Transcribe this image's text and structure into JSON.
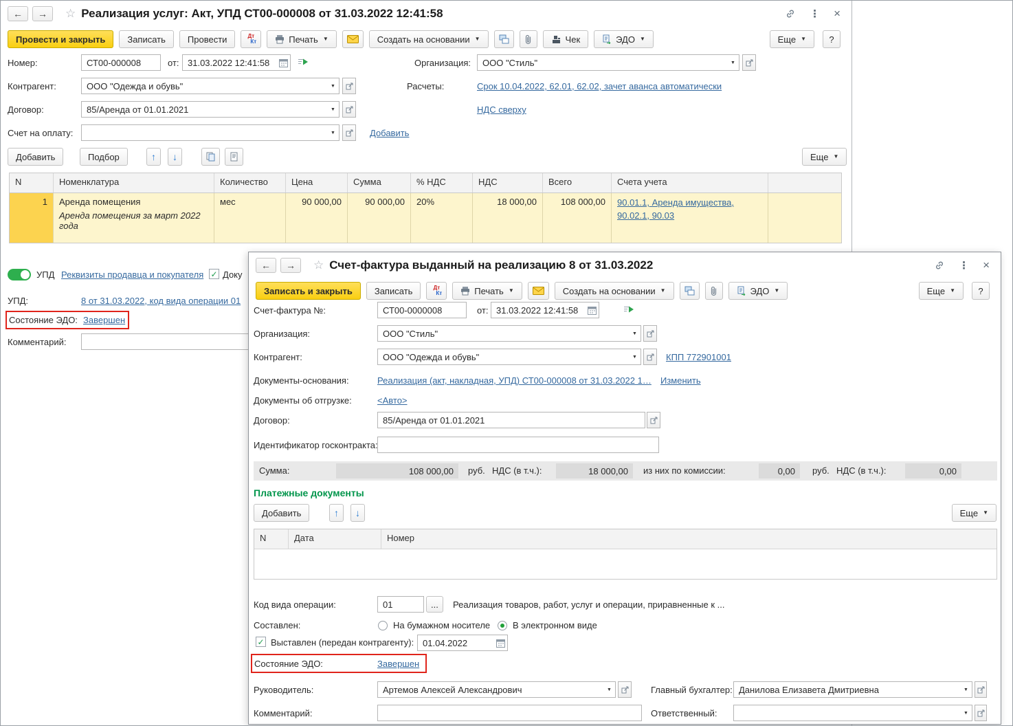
{
  "colors": {
    "accent_yellow": "#f9cf11",
    "link_blue": "#35699f",
    "section_green": "#00954b",
    "row_highlight_yellow": "#fdf5cd",
    "selected_cell_yellow": "#fcd34f",
    "annotation_red": "#e0241b",
    "toggle_green": "#2eaf4e",
    "sum_bar_gray": "#e9e9e9"
  },
  "icons": {
    "back": "←",
    "forward": "→",
    "star": "☆",
    "dots": "⋮",
    "close": "×",
    "caret": "▼",
    "dropdown": "▼",
    "up": "↑",
    "down": "↓",
    "check": "✓",
    "ellipsis": "..."
  },
  "window1": {
    "title": "Реализация услуг: Акт, УПД СТ00-000008 от 31.03.2022 12:41:58",
    "toolbar": {
      "post_and_close": "Провести и закрыть",
      "write": "Записать",
      "post": "Провести",
      "dt": "Дт",
      "kt": "Кт",
      "print": "Печать",
      "create_on_basis": "Создать на основании",
      "check": "Чек",
      "edo": "ЭДО",
      "more": "Еще",
      "help": "?"
    },
    "fields": {
      "number_label": "Номер:",
      "number": "СТ00-000008",
      "from_label": "от:",
      "date": "31.03.2022 12:41:58",
      "organization_label": "Организация:",
      "organization": "ООО \"Стиль\"",
      "contractor_label": "Контрагент:",
      "contractor": "ООО \"Одежда и обувь\"",
      "settlements_label": "Расчеты:",
      "settlements_link": "Срок 10.04.2022, 62.01, 62.02, зачет аванса автоматически",
      "contract_label": "Договор:",
      "contract": "85/Аренда от 01.01.2021",
      "vat_link": "НДС сверху",
      "payment_invoice_label": "Счет на оплату:",
      "add_link": "Добавить"
    },
    "items_toolbar": {
      "add": "Добавить",
      "pick": "Подбор",
      "more": "Еще"
    },
    "items_table": {
      "headers": [
        "N",
        "Номенклатура",
        "Количество",
        "Цена",
        "Сумма",
        "% НДС",
        "НДС",
        "Всего",
        "Счета учета"
      ],
      "rows": [
        {
          "n": "1",
          "name": "Аренда помещения",
          "note": "Аренда помещения за март 2022 года",
          "unit": "мес",
          "price": "90 000,00",
          "amount": "90 000,00",
          "vat_rate": "20%",
          "vat": "18 000,00",
          "total": "108 000,00",
          "accounts": "90.01.1, Аренда имущества, 90.02.1, 90.03"
        }
      ]
    },
    "footer": {
      "upd_toggle_label": "УПД",
      "seller_buyer_link": "Реквизиты продавца и покупателя",
      "doc_checkbox_label": "Доку",
      "upd_label": "УПД:",
      "upd_link": "8 от 31.03.2022, код вида операции 01",
      "edo_state_label": "Состояние ЭДО:",
      "edo_state_value": "Завершен",
      "comment_label": "Комментарий:"
    }
  },
  "window2": {
    "title": "Счет-фактура выданный на реализацию 8 от 31.03.2022",
    "toolbar": {
      "write_and_close": "Записать и закрыть",
      "write": "Записать",
      "dt": "Дт",
      "kt": "Кт",
      "print": "Печать",
      "create_on_basis": "Создать на основании",
      "edo": "ЭДО",
      "more": "Еще",
      "help": "?"
    },
    "fields": {
      "invoice_number_label": "Счет-фактура №:",
      "invoice_number": "СТ00-0000008",
      "from_label": "от:",
      "date": "31.03.2022 12:41:58",
      "organization_label": "Организация:",
      "organization": "ООО \"Стиль\"",
      "contractor_label": "Контрагент:",
      "contractor": "ООО \"Одежда и обувь\"",
      "kpp_link": "КПП 772901001",
      "basis_docs_label": "Документы-основания:",
      "basis_docs_link": "Реализация (акт, накладная, УПД) СТ00-000008 от 31.03.2022 1…",
      "change_link": "Изменить",
      "shipment_docs_label": "Документы об отгрузке:",
      "shipment_docs_link": "<Авто>",
      "contract_label": "Договор:",
      "contract": "85/Аренда от 01.01.2021",
      "gov_contract_label": "Идентификатор госконтракта:"
    },
    "totals": {
      "sum_label": "Сумма:",
      "sum": "108 000,00",
      "rub1": "руб.",
      "vat_label": "НДС (в т.ч.):",
      "vat": "18 000,00",
      "commission_label": "из них по комиссии:",
      "commission": "0,00",
      "rub2": "руб.",
      "vat2_label": "НДС (в т.ч.):",
      "vat2": "0,00"
    },
    "payments": {
      "title": "Платежные документы",
      "add": "Добавить",
      "more": "Еще",
      "headers": [
        "N",
        "Дата",
        "Номер"
      ]
    },
    "bottom": {
      "op_code_label": "Код вида операции:",
      "op_code": "01",
      "op_desc": "Реализация товаров, работ, услуг и операции, приравненные к ...",
      "composed_label": "Составлен:",
      "paper_option": "На бумажном носителе",
      "electronic_option": "В электронном виде",
      "issued_label": "Выставлен (передан контрагенту):",
      "issued_date": "01.04.2022",
      "edo_state_label": "Состояние ЭДО:",
      "edo_state_value": "Завершен",
      "manager_label": "Руководитель:",
      "manager": "Артемов Алексей Александрович",
      "chief_accountant_label": "Главный бухгалтер:",
      "chief_accountant": "Данилова Елизавета Дмитриевна",
      "comment_label": "Комментарий:",
      "responsible_label": "Ответственный:"
    }
  }
}
